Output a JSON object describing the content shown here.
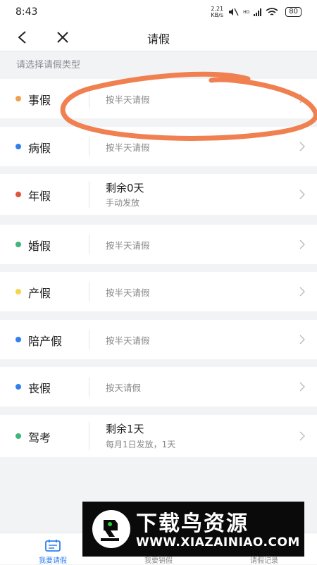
{
  "status_bar": {
    "time": "8:43",
    "net_speed_value": "2.21",
    "net_speed_unit": "KB/s",
    "hd_label": "HD",
    "battery": "80"
  },
  "nav": {
    "title": "请假",
    "back_icon": "back-chevron-icon",
    "close_icon": "close-icon"
  },
  "hint": "请选择请假类型",
  "leave_types": [
    {
      "name": "事假",
      "dot_color": "#f0a04b",
      "desc": "按半天请假"
    },
    {
      "name": "病假",
      "dot_color": "#2f80ed",
      "desc": "按半天请假"
    },
    {
      "name": "年假",
      "dot_color": "#e0533d",
      "main": "剩余0天",
      "sub": "手动发放"
    },
    {
      "name": "婚假",
      "dot_color": "#3fb57a",
      "desc": "按半天请假"
    },
    {
      "name": "产假",
      "dot_color": "#f5d54a",
      "desc": "按半天请假"
    },
    {
      "name": "陪产假",
      "dot_color": "#2f80ed",
      "desc": "按半天请假"
    },
    {
      "name": "丧假",
      "dot_color": "#2f80ed",
      "desc": "按天请假"
    },
    {
      "name": "驾考",
      "dot_color": "#3fb57a",
      "main": "剩余1天",
      "sub": "每月1日发放，1天"
    }
  ],
  "tabs": [
    {
      "label": "我要请假",
      "active": true
    },
    {
      "label": "我要销假",
      "active": false
    },
    {
      "label": "请假记录",
      "active": false
    }
  ],
  "watermark": {
    "title": "下载鸟资源",
    "url": "WWW.XIAZAINIAO.COM"
  },
  "colors": {
    "accent": "#2f80ed",
    "annotation": "#f08050"
  }
}
